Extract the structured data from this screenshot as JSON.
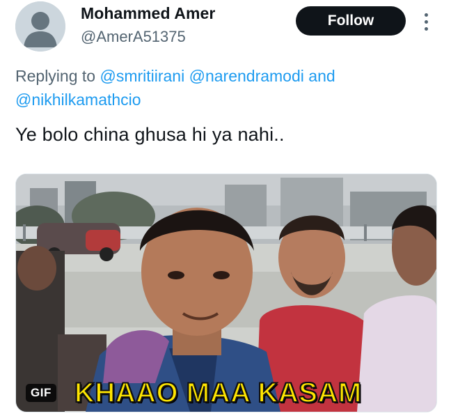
{
  "author": {
    "name": "Mohammed Amer",
    "handle": "@AmerA51375",
    "follow_label": "Follow"
  },
  "icons": {
    "avatar": "default-avatar-icon",
    "more": "more-vertical-icon"
  },
  "colors": {
    "link": "#1d9bf0",
    "secondary_text": "#536471",
    "follow_bg": "#0f1419",
    "caption_yellow": "#ffe600"
  },
  "reply": {
    "prefix": "Replying to",
    "mention_1": "@smritiirani",
    "mention_2": "@narendramodi",
    "conjunction": "and",
    "mention_3": "@nikhilkamathcio"
  },
  "tweet": {
    "text": "Ye bolo china ghusa hi ya nahi.."
  },
  "media": {
    "badge": "GIF",
    "caption": "KHAAO MAA KASAM"
  }
}
